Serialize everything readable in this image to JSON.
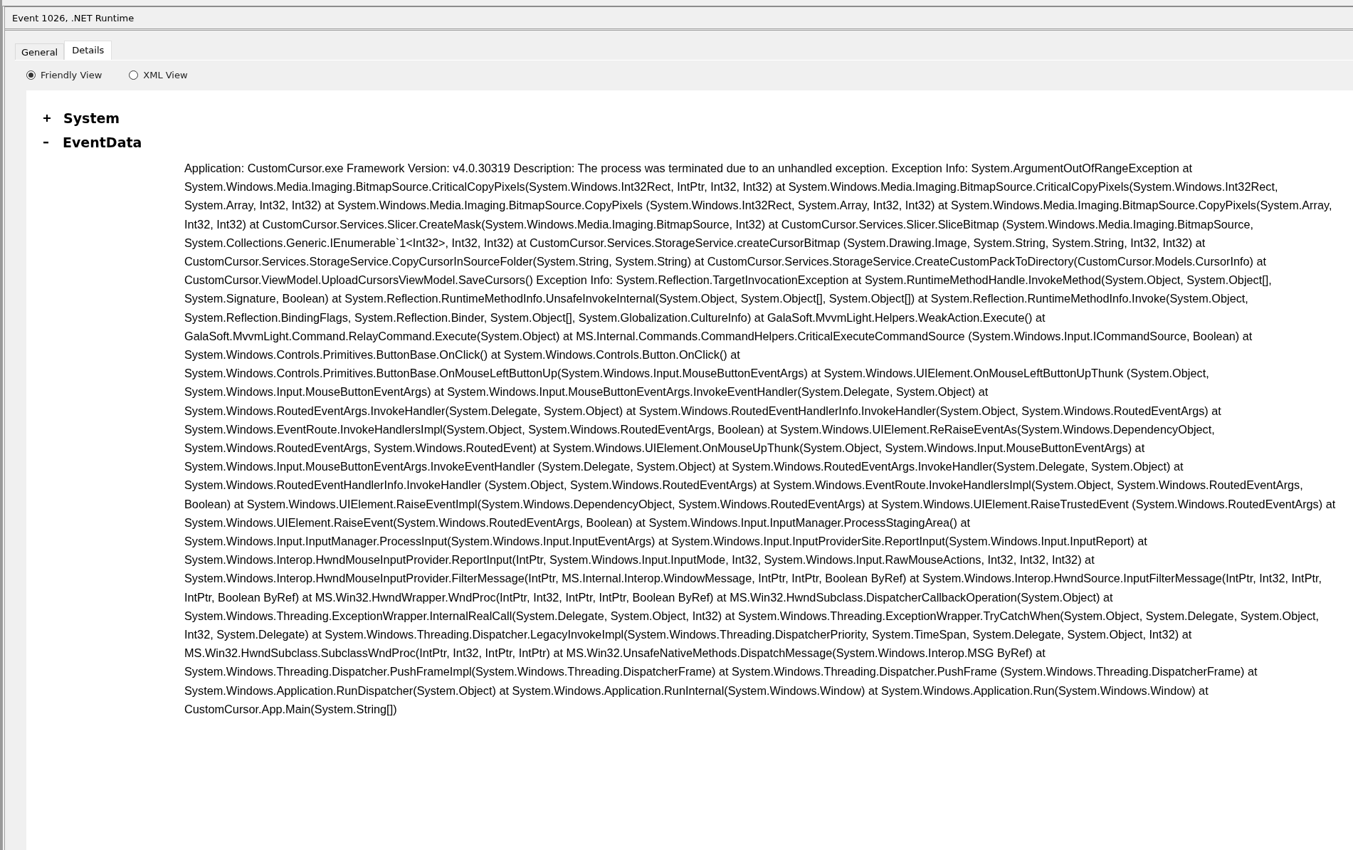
{
  "window": {
    "title": "Event 1026, .NET Runtime"
  },
  "tabs": [
    {
      "label": "General",
      "selected": false
    },
    {
      "label": "Details",
      "selected": true
    }
  ],
  "view_options": [
    {
      "label": "Friendly View",
      "selected": true
    },
    {
      "label": "XML View",
      "selected": false
    }
  ],
  "tree": [
    {
      "label": "System",
      "expanded": false
    },
    {
      "label": "EventData",
      "expanded": true,
      "text": "Application: CustomCursor.exe Framework Version: v4.0.30319 Description: The process was terminated due to an unhandled exception. Exception Info: System.ArgumentOutOfRangeException at System.Windows.Media.Imaging.BitmapSource.CriticalCopyPixels(System.Windows.Int32Rect, IntPtr, Int32, Int32) at System.Windows.Media.Imaging.BitmapSource.CriticalCopyPixels(System.Windows.Int32Rect, System.Array, Int32, Int32) at System.Windows.Media.Imaging.BitmapSource.CopyPixels (System.Windows.Int32Rect, System.Array, Int32, Int32) at System.Windows.Media.Imaging.BitmapSource.CopyPixels(System.Array, Int32, Int32) at CustomCursor.Services.Slicer.CreateMask(System.Windows.Media.Imaging.BitmapSource, Int32) at CustomCursor.Services.Slicer.SliceBitmap (System.Windows.Media.Imaging.BitmapSource, System.Collections.Generic.IEnumerable`1<Int32>, Int32, Int32) at CustomCursor.Services.StorageService.createCursorBitmap (System.Drawing.Image, System.String, System.String, Int32, Int32) at CustomCursor.Services.StorageService.CopyCursorInSourceFolder(System.String, System.String) at CustomCursor.Services.StorageService.CreateCustomPackToDirectory(CustomCursor.Models.CursorInfo) at CustomCursor.ViewModel.UploadCursorsViewModel.SaveCursors() Exception Info: System.Reflection.TargetInvocationException at System.RuntimeMethodHandle.InvokeMethod(System.Object, System.Object[], System.Signature, Boolean) at System.Reflection.RuntimeMethodInfo.UnsafeInvokeInternal(System.Object, System.Object[], System.Object[]) at System.Reflection.RuntimeMethodInfo.Invoke(System.Object, System.Reflection.BindingFlags, System.Reflection.Binder, System.Object[], System.Globalization.CultureInfo) at GalaSoft.MvvmLight.Helpers.WeakAction.Execute() at GalaSoft.MvvmLight.Command.RelayCommand.Execute(System.Object) at MS.Internal.Commands.CommandHelpers.CriticalExecuteCommandSource (System.Windows.Input.ICommandSource, Boolean) at System.Windows.Controls.Primitives.ButtonBase.OnClick() at System.Windows.Controls.Button.OnClick() at System.Windows.Controls.Primitives.ButtonBase.OnMouseLeftButtonUp(System.Windows.Input.MouseButtonEventArgs) at System.Windows.UIElement.OnMouseLeftButtonUpThunk (System.Object, System.Windows.Input.MouseButtonEventArgs) at System.Windows.Input.MouseButtonEventArgs.InvokeEventHandler(System.Delegate, System.Object) at System.Windows.RoutedEventArgs.InvokeHandler(System.Delegate, System.Object) at System.Windows.RoutedEventHandlerInfo.InvokeHandler(System.Object, System.Windows.RoutedEventArgs) at System.Windows.EventRoute.InvokeHandlersImpl(System.Object, System.Windows.RoutedEventArgs, Boolean) at System.Windows.UIElement.ReRaiseEventAs(System.Windows.DependencyObject, System.Windows.RoutedEventArgs, System.Windows.RoutedEvent) at System.Windows.UIElement.OnMouseUpThunk(System.Object, System.Windows.Input.MouseButtonEventArgs) at System.Windows.Input.MouseButtonEventArgs.InvokeEventHandler (System.Delegate, System.Object) at System.Windows.RoutedEventArgs.InvokeHandler(System.Delegate, System.Object) at System.Windows.RoutedEventHandlerInfo.InvokeHandler (System.Object, System.Windows.RoutedEventArgs) at System.Windows.EventRoute.InvokeHandlersImpl(System.Object, System.Windows.RoutedEventArgs, Boolean) at System.Windows.UIElement.RaiseEventImpl(System.Windows.DependencyObject, System.Windows.RoutedEventArgs) at System.Windows.UIElement.RaiseTrustedEvent (System.Windows.RoutedEventArgs) at System.Windows.UIElement.RaiseEvent(System.Windows.RoutedEventArgs, Boolean) at System.Windows.Input.InputManager.ProcessStagingArea() at System.Windows.Input.InputManager.ProcessInput(System.Windows.Input.InputEventArgs) at System.Windows.Input.InputProviderSite.ReportInput(System.Windows.Input.InputReport) at System.Windows.Interop.HwndMouseInputProvider.ReportInput(IntPtr, System.Windows.Input.InputMode, Int32, System.Windows.Input.RawMouseActions, Int32, Int32, Int32) at System.Windows.Interop.HwndMouseInputProvider.FilterMessage(IntPtr, MS.Internal.Interop.WindowMessage, IntPtr, IntPtr, Boolean ByRef) at System.Windows.Interop.HwndSource.InputFilterMessage(IntPtr, Int32, IntPtr, IntPtr, Boolean ByRef) at MS.Win32.HwndWrapper.WndProc(IntPtr, Int32, IntPtr, IntPtr, Boolean ByRef) at MS.Win32.HwndSubclass.DispatcherCallbackOperation(System.Object) at System.Windows.Threading.ExceptionWrapper.InternalRealCall(System.Delegate, System.Object, Int32) at System.Windows.Threading.ExceptionWrapper.TryCatchWhen(System.Object, System.Delegate, System.Object, Int32, System.Delegate) at System.Windows.Threading.Dispatcher.LegacyInvokeImpl(System.Windows.Threading.DispatcherPriority, System.TimeSpan, System.Delegate, System.Object, Int32) at MS.Win32.HwndSubclass.SubclassWndProc(IntPtr, Int32, IntPtr, IntPtr) at MS.Win32.UnsafeNativeMethods.DispatchMessage(System.Windows.Interop.MSG ByRef) at System.Windows.Threading.Dispatcher.PushFrameImpl(System.Windows.Threading.DispatcherFrame) at System.Windows.Threading.Dispatcher.PushFrame (System.Windows.Threading.DispatcherFrame) at System.Windows.Application.RunDispatcher(System.Object) at System.Windows.Application.RunInternal(System.Windows.Window) at System.Windows.Application.Run(System.Windows.Window) at CustomCursor.App.Main(System.String[])"
    }
  ]
}
